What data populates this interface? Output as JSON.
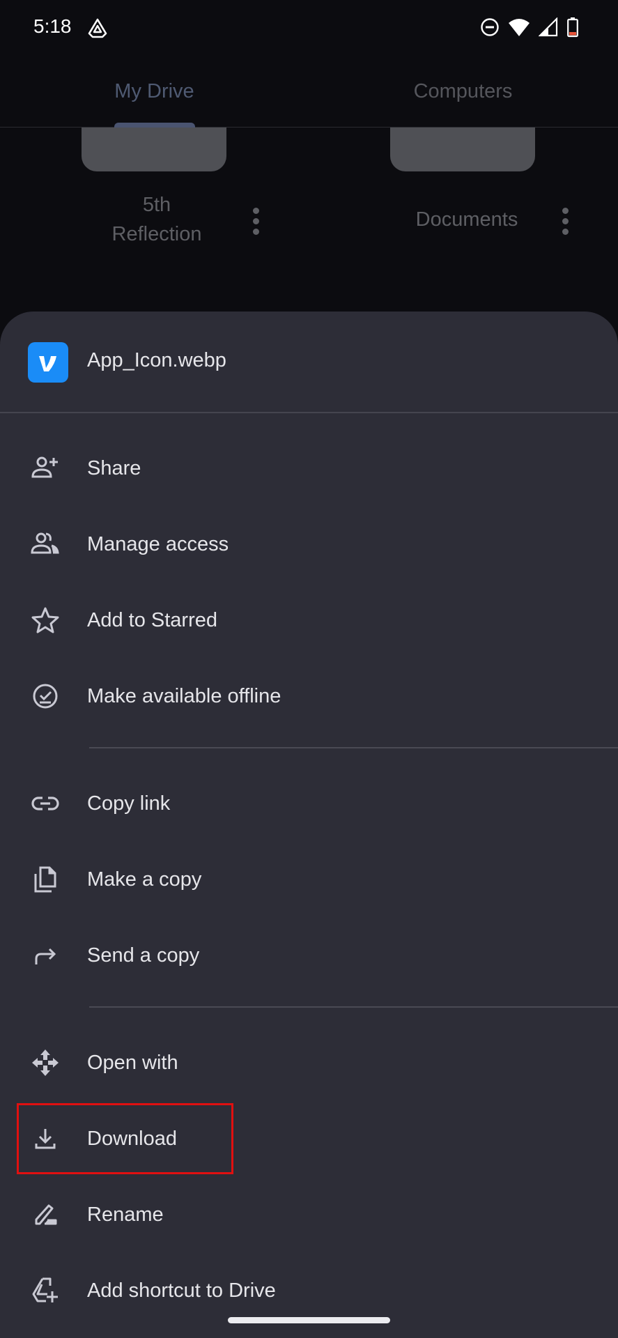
{
  "status_bar": {
    "time": "5:18",
    "left_icons": [
      "google-drive-icon"
    ],
    "right_icons": [
      "do-not-disturb-icon",
      "wifi-icon",
      "cellular-signal-icon",
      "battery-low-icon"
    ],
    "battery_color": "#e8553a"
  },
  "tabs": [
    {
      "label": "My Drive",
      "selected": true
    },
    {
      "label": "Computers",
      "selected": false
    }
  ],
  "folders": [
    {
      "name": "5th Reflection",
      "line1": "5th",
      "line2": "Reflection"
    },
    {
      "name": "Documents"
    }
  ],
  "sheet": {
    "file_name": "App_Icon.webp",
    "file_icon": "vimeo-app-icon",
    "file_icon_color": "#1a8cf7",
    "groups": [
      [
        {
          "label": "Share",
          "icon": "person-add-icon"
        },
        {
          "label": "Manage access",
          "icon": "people-icon"
        },
        {
          "label": "Add to Starred",
          "icon": "star-outline-icon"
        },
        {
          "label": "Make available offline",
          "icon": "offline-pin-icon"
        }
      ],
      [
        {
          "label": "Copy link",
          "icon": "link-icon"
        },
        {
          "label": "Make a copy",
          "icon": "copy-icon"
        },
        {
          "label": "Send a copy",
          "icon": "forward-arrow-icon"
        }
      ],
      [
        {
          "label": "Open with",
          "icon": "open-with-icon"
        },
        {
          "label": "Download",
          "icon": "download-icon",
          "highlighted": true
        },
        {
          "label": "Rename",
          "icon": "rename-pencil-icon"
        },
        {
          "label": "Add shortcut to Drive",
          "icon": "drive-shortcut-icon"
        }
      ]
    ]
  },
  "highlight": {
    "target": "Download",
    "color": "#e01010"
  }
}
